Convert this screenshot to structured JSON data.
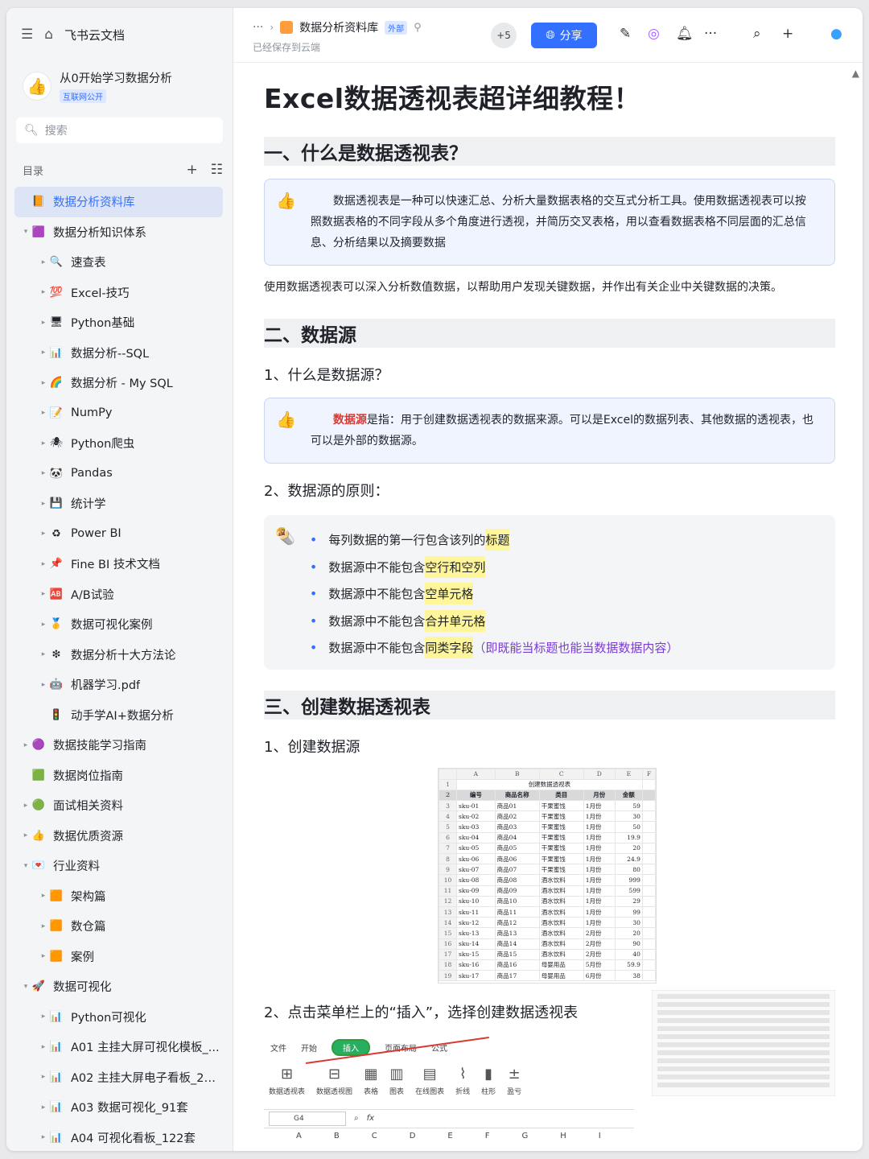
{
  "sidebar": {
    "brand": "飞书云文档",
    "space_name": "从0开始学习数据分析",
    "space_tag": "互联网公开",
    "search_placeholder": "搜索",
    "toc_label": "目录",
    "items": [
      {
        "label": "数据分析资料库",
        "level": 0,
        "icon": "📙",
        "active": true,
        "toggle": ""
      },
      {
        "label": "数据分析知识体系",
        "level": 0,
        "icon": "🟪",
        "toggle": "▾"
      },
      {
        "label": "速查表",
        "level": 1,
        "icon": "🔍",
        "toggle": "▸"
      },
      {
        "label": "Excel-技巧",
        "level": 1,
        "icon": "💯",
        "toggle": "▸"
      },
      {
        "label": "Python基础",
        "level": 1,
        "icon": "🖥",
        "toggle": "▸"
      },
      {
        "label": "数据分析--SQL",
        "level": 1,
        "icon": "📊",
        "toggle": "▸"
      },
      {
        "label": "数据分析 - My SQL",
        "level": 1,
        "icon": "🌈",
        "toggle": "▸"
      },
      {
        "label": "NumPy",
        "level": 1,
        "icon": "📝",
        "toggle": "▸"
      },
      {
        "label": "Python爬虫",
        "level": 1,
        "icon": "🕷",
        "toggle": "▸"
      },
      {
        "label": "Pandas",
        "level": 1,
        "icon": "🐼",
        "toggle": "▸"
      },
      {
        "label": "统计学",
        "level": 1,
        "icon": "💾",
        "toggle": "▸"
      },
      {
        "label": "Power BI",
        "level": 1,
        "icon": "♻",
        "toggle": "▸"
      },
      {
        "label": "Fine BI 技术文档",
        "level": 1,
        "icon": "📌",
        "toggle": "▸"
      },
      {
        "label": "A/B试验",
        "level": 1,
        "icon": "🆎",
        "toggle": "▸"
      },
      {
        "label": "数据可视化案例",
        "level": 1,
        "icon": "🥇",
        "toggle": "▸"
      },
      {
        "label": "数据分析十大方法论",
        "level": 1,
        "icon": "❇",
        "toggle": "▸"
      },
      {
        "label": "机器学习.pdf",
        "level": 1,
        "icon": "🤖",
        "toggle": "▸"
      },
      {
        "label": "动手学AI+数据分析",
        "level": 1,
        "icon": "🚦",
        "toggle": ""
      },
      {
        "label": "数据技能学习指南",
        "level": 0,
        "icon": "🟣",
        "toggle": "▸"
      },
      {
        "label": "数据岗位指南",
        "level": 0,
        "icon": "🟩",
        "toggle": ""
      },
      {
        "label": "面试相关资料",
        "level": 0,
        "icon": "🟢",
        "toggle": "▸"
      },
      {
        "label": "数据优质资源",
        "level": 0,
        "icon": "👍",
        "toggle": "▸"
      },
      {
        "label": "行业资料",
        "level": 0,
        "icon": "💌",
        "toggle": "▾"
      },
      {
        "label": "架构篇",
        "level": 1,
        "icon": "🟧",
        "toggle": "▸"
      },
      {
        "label": "数仓篇",
        "level": 1,
        "icon": "🟧",
        "toggle": "▸"
      },
      {
        "label": "案例",
        "level": 1,
        "icon": "🟧",
        "toggle": "▸"
      },
      {
        "label": "数据可视化",
        "level": 0,
        "icon": "🚀",
        "toggle": "▾"
      },
      {
        "label": "Python可视化",
        "level": 1,
        "icon": "📊",
        "toggle": "▸"
      },
      {
        "label": "A01 主挂大屏可视化模板_...",
        "level": 1,
        "icon": "📊",
        "toggle": "▸"
      },
      {
        "label": "A02 主挂大屏电子看板_20套",
        "level": 1,
        "icon": "📊",
        "toggle": "▸"
      },
      {
        "label": "A03 数据可视化_91套",
        "level": 1,
        "icon": "📊",
        "toggle": "▸"
      },
      {
        "label": "A04 可视化看板_122套",
        "level": 1,
        "icon": "📊",
        "toggle": "▸"
      }
    ]
  },
  "topbar": {
    "dots": "···",
    "doc_name": "数据分析资料库",
    "ext_tag": "外部",
    "saved": "已经保存到云端",
    "collaborators": "+5",
    "share_label": "分享"
  },
  "doc": {
    "title": "Excel数据透视表超详细教程！",
    "s1_title": "一、什么是数据透视表？",
    "s1_callout": "数据透视表是一种可以快速汇总、分析大量数据表格的交互式分析工具。使用数据透视表可以按照数据表格的不同字段从多个角度进行透视，并简历交叉表格，用以查看数据表格不同层面的汇总信息、分析结果以及摘要数据",
    "s1_para": "使用数据透视表可以深入分析数值数据，以帮助用户发现关键数据，并作出有关企业中关键数据的决策。",
    "s2_title": "二、数据源",
    "s2_h1": "1、什么是数据源？",
    "s2_callout_red": "数据源",
    "s2_callout_rest": "是指：用于创建数据透视表的数据来源。可以是Excel的数据列表、其他数据的透视表，也可以是外部的数据源。",
    "s2_h2": "2、数据源的原则：",
    "bullets": [
      {
        "pre": "每列数据的第一行包含该列的",
        "hl": "标题",
        "post": ""
      },
      {
        "pre": "数据源中不能包含",
        "hl": "空行和空列",
        "post": ""
      },
      {
        "pre": "数据源中不能包含",
        "hl": "空单元格",
        "post": ""
      },
      {
        "pre": "数据源中不能包含",
        "hl": "合并单元格",
        "post": ""
      },
      {
        "pre": "数据源中不能包含",
        "hl": "同类字段",
        "post": "（即既能当标题也能当数据数据内容）"
      }
    ],
    "s3_title": "三、创建数据透视表",
    "s3_h1": "1、创建数据源",
    "s3_h2": "2、点击菜单栏上的“插入”，选择创建数据透视表"
  },
  "sheet": {
    "col_letters": [
      "A",
      "B",
      "C",
      "D",
      "E",
      "F"
    ],
    "title": "创建数据透视表",
    "headers": [
      "编号",
      "商品名称",
      "类目",
      "月份",
      "金额"
    ],
    "rows": [
      [
        "sku-01",
        "商品01",
        "干果蜜饯",
        "1月份",
        "59"
      ],
      [
        "sku-02",
        "商品02",
        "干果蜜饯",
        "1月份",
        "30"
      ],
      [
        "sku-03",
        "商品03",
        "干果蜜饯",
        "1月份",
        "50"
      ],
      [
        "sku-04",
        "商品04",
        "干果蜜饯",
        "1月份",
        "19.9"
      ],
      [
        "sku-05",
        "商品05",
        "干果蜜饯",
        "1月份",
        "20"
      ],
      [
        "sku-06",
        "商品06",
        "干果蜜饯",
        "1月份",
        "24.9"
      ],
      [
        "sku-07",
        "商品07",
        "干果蜜饯",
        "1月份",
        "80"
      ],
      [
        "sku-08",
        "商品08",
        "酒水饮料",
        "1月份",
        "999"
      ],
      [
        "sku-09",
        "商品09",
        "酒水饮料",
        "1月份",
        "599"
      ],
      [
        "sku-10",
        "商品10",
        "酒水饮料",
        "1月份",
        "29"
      ],
      [
        "sku-11",
        "商品11",
        "酒水饮料",
        "1月份",
        "99"
      ],
      [
        "sku-12",
        "商品12",
        "酒水饮料",
        "1月份",
        "30"
      ],
      [
        "sku-13",
        "商品13",
        "酒水饮料",
        "2月份",
        "20"
      ],
      [
        "sku-14",
        "商品14",
        "酒水饮料",
        "2月份",
        "90"
      ],
      [
        "sku-15",
        "商品15",
        "酒水饮料",
        "2月份",
        "40"
      ],
      [
        "sku-16",
        "商品16",
        "母婴用品",
        "5月份",
        "59.9"
      ],
      [
        "sku-17",
        "商品17",
        "母婴用品",
        "6月份",
        "38"
      ]
    ]
  },
  "ribbon": {
    "menu": [
      "文件",
      "开始",
      "插入",
      "页面布局",
      "公式"
    ],
    "tools": [
      "数据透视表",
      "数据透视图",
      "表格",
      "图表",
      "在线图表",
      "折线",
      "柱形",
      "盈亏"
    ],
    "cell_ref": "G4",
    "fx": "fx",
    "cols": [
      "A",
      "B",
      "C",
      "D",
      "E",
      "F",
      "G",
      "H",
      "I"
    ]
  },
  "colors": {
    "accent": "#3370ff",
    "highlight": "#fff59a",
    "red": "#d83931"
  }
}
